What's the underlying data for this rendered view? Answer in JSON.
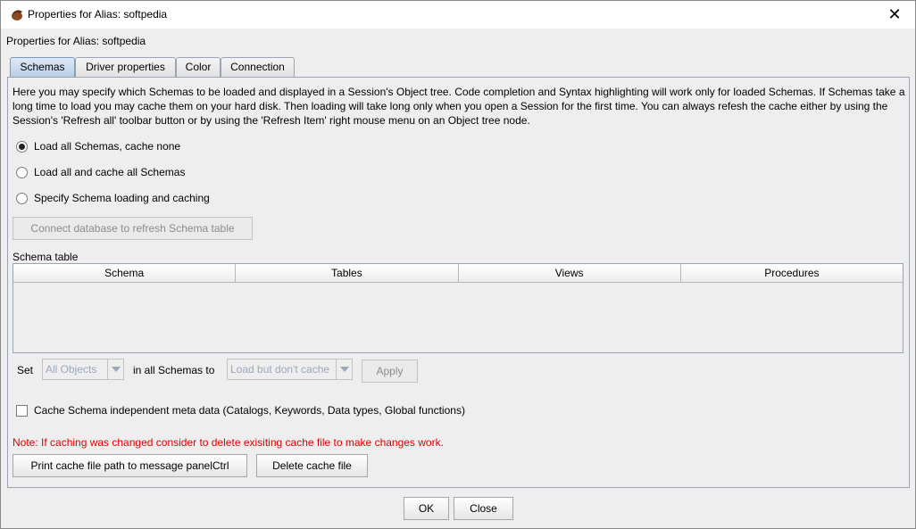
{
  "window": {
    "title": "Properties for Alias: softpedia",
    "close_glyph": "✕"
  },
  "header": {
    "label": "Properties for Alias: softpedia"
  },
  "tabs": [
    {
      "label": "Schemas",
      "active": true
    },
    {
      "label": "Driver properties",
      "active": false
    },
    {
      "label": "Color",
      "active": false
    },
    {
      "label": "Connection",
      "active": false
    }
  ],
  "schemas": {
    "description": "Here you may specify which Schemas to be loaded and displayed in a Session's Object tree. Code completion and Syntax highlighting will work only for loaded Schemas. If Schemas take a long time to load you may cache them on your hard disk. Then loading will take long only when you open a Session for the first time. You can always refesh the cache either by using the Session's 'Refresh all' toolbar button or by using the 'Refresh Item' right mouse menu on an Object tree node.",
    "radios": [
      {
        "label": "Load all Schemas, cache none",
        "selected": true
      },
      {
        "label": "Load all and cache all Schemas",
        "selected": false
      },
      {
        "label": "Specify Schema loading and caching",
        "selected": false
      }
    ],
    "connect_button": "Connect database to refresh Schema table",
    "table_label": "Schema table",
    "columns": [
      "Schema",
      "Tables",
      "Views",
      "Procedures"
    ],
    "set_label": "Set",
    "objects_combo": "All Objects",
    "in_all_label": "in all Schemas to",
    "load_combo": "Load but don't cache",
    "apply_button": "Apply",
    "cache_checkbox": "Cache Schema independent meta data (Catalogs, Keywords, Data types, Global functions)",
    "note": "Note: If caching was changed consider to delete exisiting cache file to make changes work.",
    "print_button": "Print cache file path to message panelCtrl",
    "delete_button": "Delete cache file"
  },
  "footer": {
    "ok": "OK",
    "close": "Close"
  },
  "colors": {
    "note_red": "#e00000",
    "active_tab": "#b8cfe8"
  }
}
